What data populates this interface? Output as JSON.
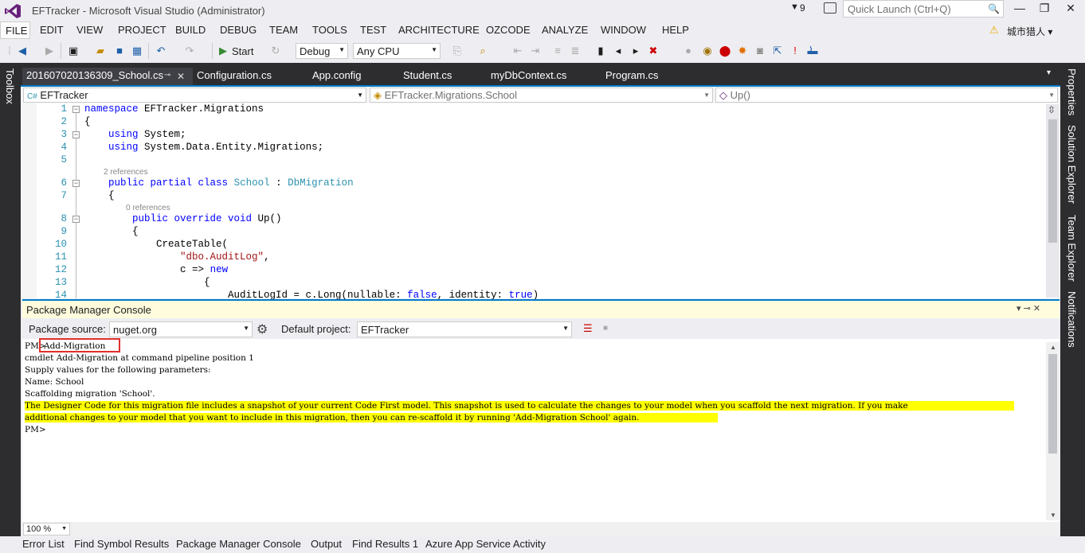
{
  "window": {
    "title": "EFTracker - Microsoft Visual Studio (Administrator)",
    "notification_count": "9",
    "quick_launch_placeholder": "Quick Launch (Ctrl+Q)",
    "minimize": "—",
    "restore": "❐",
    "close": "✕"
  },
  "menu": [
    "FILE",
    "EDIT",
    "VIEW",
    "PROJECT",
    "BUILD",
    "DEBUG",
    "TEAM",
    "TOOLS",
    "TEST",
    "ARCHITECTURE",
    "OZCODE",
    "ANALYZE",
    "WINDOW",
    "HELP"
  ],
  "user": {
    "name": "城市猎人"
  },
  "toolbar": {
    "start_label": "Start",
    "config_value": "Debug",
    "platform_value": "Any CPU"
  },
  "left_strip": {
    "toolbox": "Toolbox"
  },
  "right_strip": [
    "Properties",
    "Solution Explorer",
    "Team Explorer",
    "Notifications"
  ],
  "tabs": [
    {
      "label": "201607020136309_School.cs",
      "active": true
    },
    {
      "label": "Configuration.cs"
    },
    {
      "label": "App.config"
    },
    {
      "label": "Student.cs"
    },
    {
      "label": "myDbContext.cs"
    },
    {
      "label": "Program.cs"
    }
  ],
  "nav": {
    "project": "EFTracker",
    "class": "EFTracker.Migrations.School",
    "member": "Up()"
  },
  "code": {
    "l1": "1",
    "l2": "2",
    "l3": "3",
    "l4": "4",
    "l5": "5",
    "l6": "6",
    "l7": "7",
    "l8": "8",
    "l9": "9",
    "l10": "10",
    "l11": "11",
    "l12": "12",
    "l13": "13",
    "l14": "14",
    "refs_class": "2 references",
    "refs_method": "0 references",
    "t1_kw": "namespace",
    "t1_rest": " EFTracker.Migrations",
    "t2": "{",
    "t3_kw": "using",
    "t3_rest": " System;",
    "t4_kw": "using",
    "t4_rest": " System.Data.Entity.Migrations;",
    "t6_kw": "public partial class",
    "t6_ty": "School",
    "t6_sep": " : ",
    "t6_base": "DbMigration",
    "t7": "{",
    "t8_kw": "public override void",
    "t8_rest": " Up()",
    "t9": "{",
    "t10": "CreateTable(",
    "t11_str": "\"dbo.AuditLog\"",
    "t11_rest": ",",
    "t12_pre": "c =>",
    "t12_kw": "new",
    "t13": "{",
    "t14_pre": "AuditLogId = c.Long(nullable: ",
    "t14_false": "false",
    "t14_mid": ", identity: ",
    "t14_true": "true",
    "t14_end": ")"
  },
  "pmc": {
    "title": "Package Manager Console",
    "package_source_label": "Package source:",
    "package_source_value": "nuget.org",
    "default_project_label": "Default project:",
    "default_project_value": "EFTracker",
    "prompt": "PM>",
    "command": "Add-Migration",
    "lines": [
      "cmdlet Add-Migration at command pipeline position 1",
      "Supply values for the following parameters:",
      "Name: School",
      "Scaffolding migration 'School'."
    ],
    "highlight_1": "The Designer Code for this migration file includes a snapshot of your current Code First model. This snapshot is used to calculate the changes to your model when you scaffold the next migration. If you make",
    "highlight_2": "additional changes to your model that you want to include in this migration, then you can re-scaffold it by running 'Add-Migration School' again.",
    "final_prompt": "PM>",
    "zoom": "100 %"
  },
  "bottom_tabs": [
    "Error List",
    "Find Symbol Results",
    "Package Manager Console",
    "Output",
    "Find Results 1",
    "Azure App Service Activity"
  ],
  "colors": {
    "accent": "#007acc",
    "highlight": "#ffff00",
    "dark_chrome": "#2d2d30"
  }
}
